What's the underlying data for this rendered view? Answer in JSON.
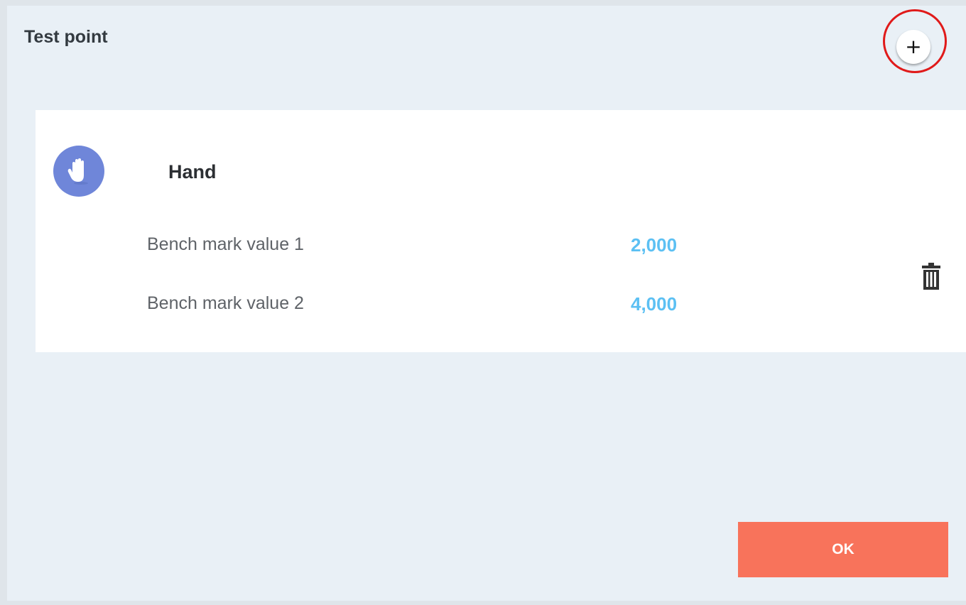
{
  "header": {
    "title": "Test point",
    "add_button_symbol": "+"
  },
  "card": {
    "icon": "hand-icon",
    "title": "Hand",
    "rows": [
      {
        "label": "Bench mark value 1",
        "value": "2,000"
      },
      {
        "label": "Bench mark value 2",
        "value": "4,000"
      }
    ],
    "delete_icon": "trash-icon"
  },
  "footer": {
    "ok_label": "OK"
  },
  "colors": {
    "accent_value": "#5cc0f3",
    "ok_button": "#f8735b",
    "avatar_bg": "#6f86d9",
    "highlight_ring": "#e01a1a"
  }
}
